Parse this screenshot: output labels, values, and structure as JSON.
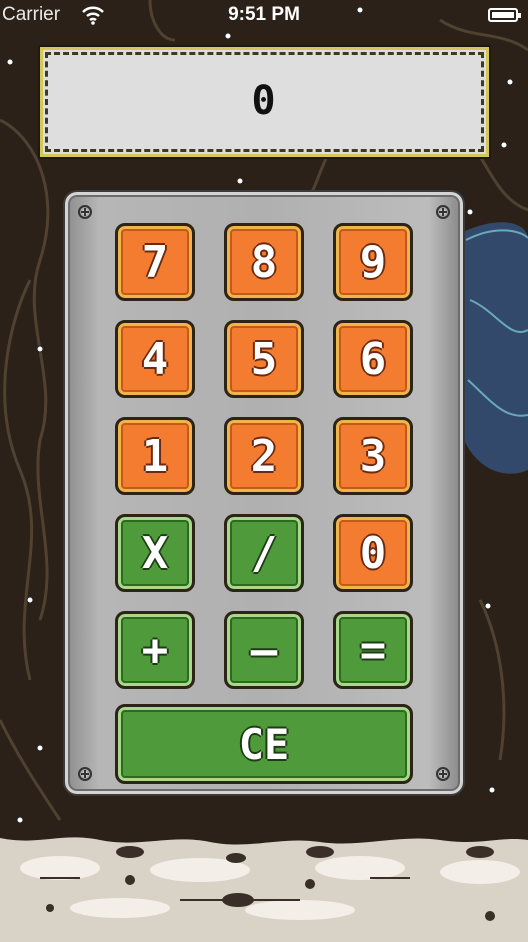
{
  "status_bar": {
    "carrier": "Carrier",
    "time": "9:51 PM"
  },
  "display": {
    "value": "0"
  },
  "keypad": {
    "rows": [
      [
        {
          "label": "7",
          "color": "orange"
        },
        {
          "label": "8",
          "color": "orange"
        },
        {
          "label": "9",
          "color": "orange"
        }
      ],
      [
        {
          "label": "4",
          "color": "orange"
        },
        {
          "label": "5",
          "color": "orange"
        },
        {
          "label": "6",
          "color": "orange"
        }
      ],
      [
        {
          "label": "1",
          "color": "orange"
        },
        {
          "label": "2",
          "color": "orange"
        },
        {
          "label": "3",
          "color": "orange"
        }
      ],
      [
        {
          "label": "X",
          "color": "green"
        },
        {
          "label": "/",
          "color": "green"
        },
        {
          "label": "0",
          "color": "orange"
        }
      ],
      [
        {
          "label": "+",
          "color": "green"
        },
        {
          "label": "—",
          "color": "green"
        },
        {
          "label": "=",
          "color": "green"
        }
      ]
    ],
    "clear_label": "CE"
  },
  "colors": {
    "orange_key": "#f47c30",
    "green_key": "#4f9a3a",
    "display_bg": "#dedede",
    "panel": "#b0b0b0",
    "background": "#2b2119"
  }
}
